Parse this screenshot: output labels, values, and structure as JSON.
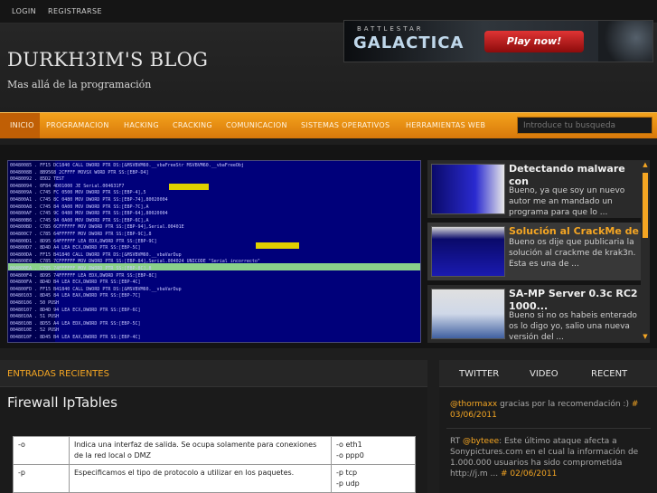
{
  "topbar": {
    "login": "LOGIN",
    "register": "REGISTRARSE"
  },
  "header": {
    "title": "DURKH3IM'S BLOG",
    "subtitle": "Mas allá de la programación"
  },
  "banner": {
    "line1": "BATTLESTAR",
    "line2": "GALACTICA",
    "cta": "Play now!"
  },
  "nav": {
    "items": [
      "INICIO",
      "PROGRAMACION",
      "HACKING",
      "CRACKING",
      "COMUNICACION",
      "SISTEMAS OPERATIVOS",
      "HERRAMIENTAS WEB"
    ],
    "active": "INICIO"
  },
  "search": {
    "placeholder": "Introduce tu busqueda"
  },
  "slider": {
    "code_lines": [
      "00480085  .  FF15 DC1840  CALL DWORD PTR DS:[&MSVBVM60.__vbaFreeStr  MSVBVM60.__vbaFreeObj",
      "0048008B  .  8B9568 2CFFFF MOVSX  WORD PTR SS:[EBP-D4]",
      "00480092  .  85D2          TEST",
      "00480094  .  0F84 4D01000  JE  Serial.004631F7",
      "0048009A  .  C745 FC 0500  MOV DWORD PTR SS:[EBP-4],5",
      "004800A1  .  C745 8C 0480  MOV DWORD PTR SS:[EBP-74],80020004",
      "004800A8  .  C745 84 0A00  MOV DWORD PTR SS:[EBP-7C],A",
      "004800AF  .  C745 9C 0480  MOV DWORD PTR SS:[EBP-64],80020004",
      "004800B6  .  C745 94 0A00  MOV DWORD PTR SS:[EBP-6C],A",
      "004800BD  .  C785 6CFFFFFF MOV DWORD PTR SS:[EBP-94],Serial.00401E",
      "004800C7  .  C785 64FFFFFF MOV DWORD PTR SS:[EBP-9C],8",
      "004800D1  .  8D95 64FFFFFF LEA EDX,DWORD PTR SS:[EBP-9C]",
      "004800D7  .  8D4D A4       LEA ECX,DWORD PTR SS:[EBP-5C]",
      "004800DA  .  FF15 B41840  CALL DWORD PTR DS:[&MSVBVM60.__vbaVarDup",
      "004800E0  .  C785 7CFFFFFF MOV DWORD PTR SS:[EBP-84],Serial.004024  UNICODE \"Serial incorrecto\"",
      "004800EA  .  C785 74FFFFFF MOV DWORD PTR SS:[EBP-8C],8",
      "004800F4  .  8D95 74FFFFFF LEA EDX,DWORD PTR SS:[EBP-8C]",
      "004800FA  .  8D4D B4       LEA ECX,DWORD PTR SS:[EBP-4C]",
      "004800FD  .  FF15 B41840  CALL DWORD PTR DS:[&MSVBVM60.__vbaVarDup",
      "00480103  .  8D45 84       LEA EAX,DWORD PTR SS:[EBP-7C]",
      "00480106  .  50            PUSH",
      "00480107  .  8D4D 94       LEA ECX,DWORD PTR SS:[EBP-6C]",
      "0048010A  .  51            PUSH",
      "0048010B  .  8D55 A4       LEA EDX,DWORD PTR SS:[EBP-5C]",
      "0048010E  .  52            PUSH",
      "0048010F  .  8D45 B4       LEA EAX,DWORD PTR SS:[EBP-4C]"
    ],
    "items": [
      {
        "title": "Detectando malware con",
        "desc": "Bueno, ya que soy un nuevo autor me an mandado un programa para que lo ..."
      },
      {
        "title": "Solución al CrackMe de",
        "desc": "Bueno os dije que publicaria la solución al crackme de krak3n. Esta es una de ..."
      },
      {
        "title": "SA-MP Server 0.3c RC2 1000...",
        "desc": "Bueno si no os habeis enterado os lo digo yo, salio una nueva versión del ..."
      }
    ]
  },
  "recent": {
    "heading": "ENTRADAS RECIENTES",
    "post_title": "Firewall IpTables",
    "table": [
      {
        "opt": "-o",
        "desc": "Indica una interfaz de salida. Se ocupa solamente para conexiones de la red local o DMZ",
        "ex1": "-o eth1",
        "ex2": "-o ppp0"
      },
      {
        "opt": "-p",
        "desc": "Especificamos el tipo de protocolo a utilizar en los paquetes.",
        "ex1": "-p tcp",
        "ex2": "-p udp"
      }
    ]
  },
  "sidebar": {
    "tabs": [
      "TWITTER",
      "VIDEO",
      "RECENT"
    ],
    "tweets": [
      {
        "handle": "@thormaxx",
        "text": " gracias por la recomendación :) ",
        "hash": "#",
        "date": " 03/06/2011"
      },
      {
        "prefix": "RT ",
        "handle": "@byteee",
        "text": ": Este último ataque afecta a Sonypictures.com en el cual la información de 1.000.000 usuarios ha sido comprometida http://j.m ... ",
        "hash": "#",
        "date": " 02/06/2011"
      }
    ]
  }
}
